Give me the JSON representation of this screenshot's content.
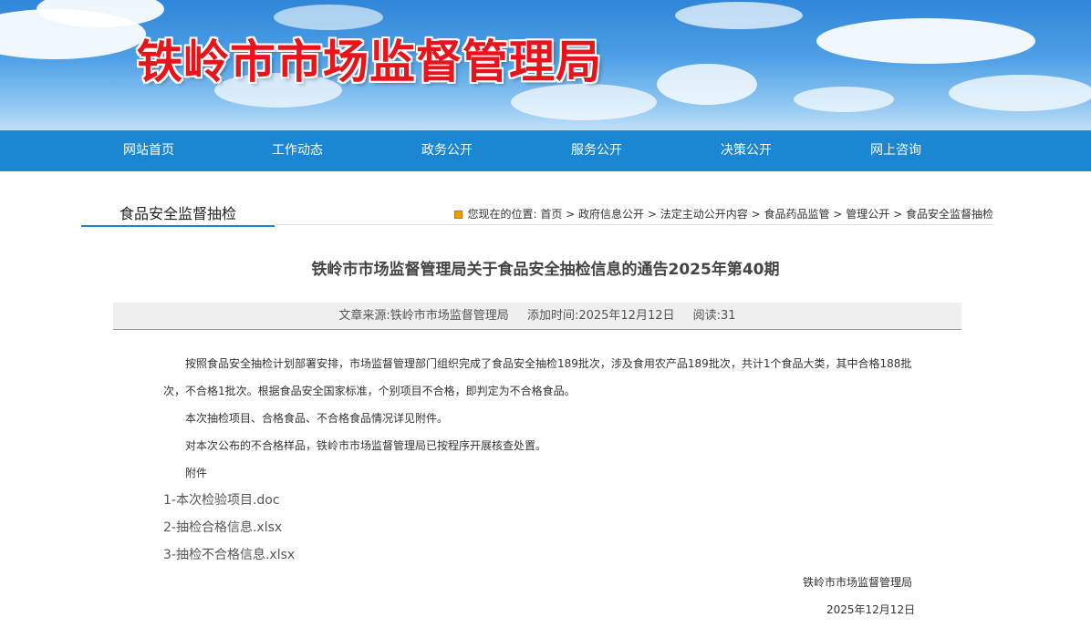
{
  "site": {
    "title": "铁岭市市场监督管理局"
  },
  "nav": [
    "网站首页",
    "工作动态",
    "政务公开",
    "服务公开",
    "决策公开",
    "网上咨询"
  ],
  "column": {
    "title": "食品安全监督抽检"
  },
  "breadcrumb": {
    "prefix": "您现在的位置:",
    "items": [
      "首页",
      "政府信息公开",
      "法定主动公开内容",
      "食品药品监管",
      "管理公开",
      "食品安全监督抽检"
    ],
    "separator": ">"
  },
  "article": {
    "title": "铁岭市市场监督管理局关于食品安全抽检信息的通告2025年第40期",
    "meta": {
      "source": "文章来源:铁岭市市场监督管理局",
      "time": "添加时间:2025年12月12日",
      "views": "阅读:31"
    },
    "para1_line1": "按照食品安全抽检计划部署安排，市场监督管理部门组织完成了食品安全抽检189批次，涉及食用农产品189批次，共计1个食品大类，其中合格188批",
    "para1_line2": "次，不合格1批次。根据食品安全国家标准，个别项目不合格，即判定为不合格食品。",
    "para2": "本次抽检项目、合格食品、不合格食品情况详见附件。",
    "para3": "对本次公布的不合格样品，铁岭市市场监督管理局已按程序开展核查处置。",
    "attach_label": "附件",
    "attachments": [
      "1-本次检验项目.doc",
      "2-抽检合格信息.xlsx",
      "3-抽检不合格信息.xlsx"
    ],
    "signature": "铁岭市市场监督管理局",
    "date": "2025年12月12日"
  }
}
